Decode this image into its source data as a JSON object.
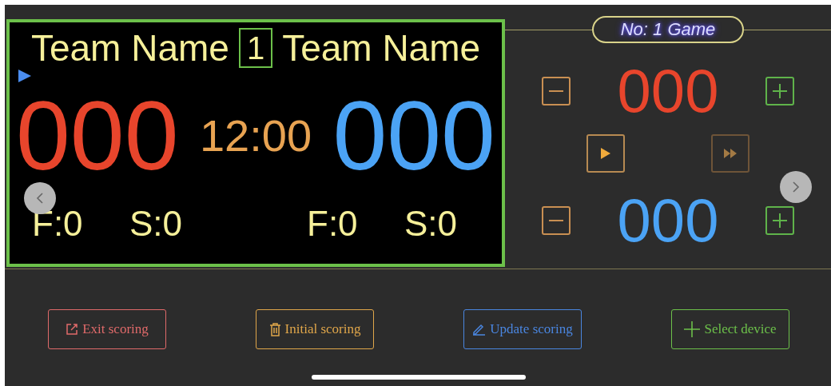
{
  "scoreboard": {
    "home_name": "Team Name",
    "period": "1",
    "away_name": "Team Name",
    "home_score": "000",
    "clock": "12:00",
    "away_score": "000",
    "home_stats": [
      "F:0",
      "S:0"
    ],
    "away_stats": [
      "F:0",
      "S:0"
    ]
  },
  "control_panel": {
    "game_label": "No: 1 Game",
    "home_score": "000",
    "away_score": "000"
  },
  "buttons": [
    {
      "kind": "exit",
      "label": "Exit scoring",
      "color": "#e06a6a"
    },
    {
      "kind": "trash",
      "label": "Initial scoring",
      "color": "#e0a64a"
    },
    {
      "kind": "edit",
      "label": "Update scoring",
      "color": "#4a86e0"
    },
    {
      "kind": "add",
      "label": "Select device",
      "color": "#6cc04a"
    }
  ]
}
